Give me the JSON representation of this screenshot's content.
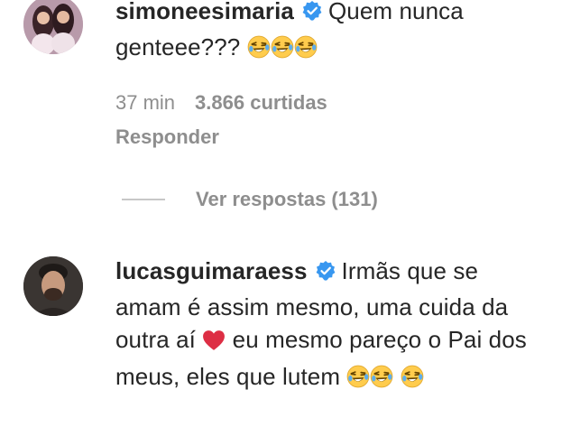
{
  "comments": [
    {
      "username": "simoneesimaria",
      "text": "Quem nunca genteee???",
      "emojis": [
        "rolling-on-floor-laughing",
        "rolling-on-floor-laughing",
        "rolling-on-floor-laughing"
      ],
      "time": "37 min",
      "likes": "3.866 curtidas",
      "reply_label": "Responder",
      "view_replies_label": "Ver respostas (131)"
    },
    {
      "username": "lucasguimaraess",
      "text_part1": "Irmãs que se amam é assim mesmo, uma cuida da outra aí",
      "text_part2": "eu mesmo pareço o Pai dos meus, eles que lutem",
      "emojis": [
        "red-heart",
        "rolling-on-floor-laughing",
        "rolling-on-floor-laughing",
        "rolling-on-floor-laughing"
      ]
    }
  ],
  "colors": {
    "text": "#262626",
    "secondary": "#8e8e8e",
    "verified": "#3897f0",
    "divider": "#c7c7c7"
  }
}
